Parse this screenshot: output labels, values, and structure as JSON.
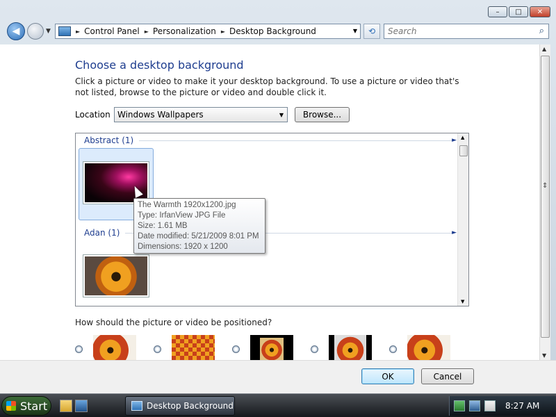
{
  "window": {
    "controls": {
      "minimize": "–",
      "maximize": "□",
      "close": "✕"
    }
  },
  "nav": {
    "back_glyph": "◀",
    "history_glyph": "▼",
    "breadcrumbs": [
      "Control Panel",
      "Personalization",
      "Desktop Background"
    ],
    "crumb_separator": "►",
    "address_dropdown_glyph": "▼",
    "refresh_glyph": "⟲",
    "search_placeholder": "Search",
    "search_glyph": "⌕"
  },
  "page": {
    "title": "Choose a desktop background",
    "instructions": "Click a picture or video to make it your desktop background. To use a picture or video that's not listed, browse to the picture or video and double click it.",
    "location_label": "Location",
    "location_value": "Windows Wallpapers",
    "browse_label": "Browse..."
  },
  "wallpaper_groups": [
    {
      "label": "Abstract (1)",
      "expander": "►"
    },
    {
      "label": "Adan (1)",
      "expander": "►"
    }
  ],
  "tooltip": {
    "lines": [
      "The Warmth 1920x1200.jpg",
      "Type: IrfanView JPG File",
      "Size: 1.61 MB",
      "Date modified: 5/21/2009 8:01 PM",
      "Dimensions: 1920 x 1200"
    ]
  },
  "positioning": {
    "question": "How should the picture or video be positioned?",
    "options": [
      "stretch",
      "tile",
      "center",
      "fit",
      "fill"
    ]
  },
  "footer": {
    "ok_label": "OK",
    "cancel_label": "Cancel"
  },
  "taskbar": {
    "start_label": "Start",
    "task_label": "Desktop Background",
    "clock": "8:27 AM"
  },
  "colors": {
    "title_blue": "#1e3d8f",
    "selection_bg": "#dcebfc",
    "ok_accent": "#3c7fb1"
  }
}
